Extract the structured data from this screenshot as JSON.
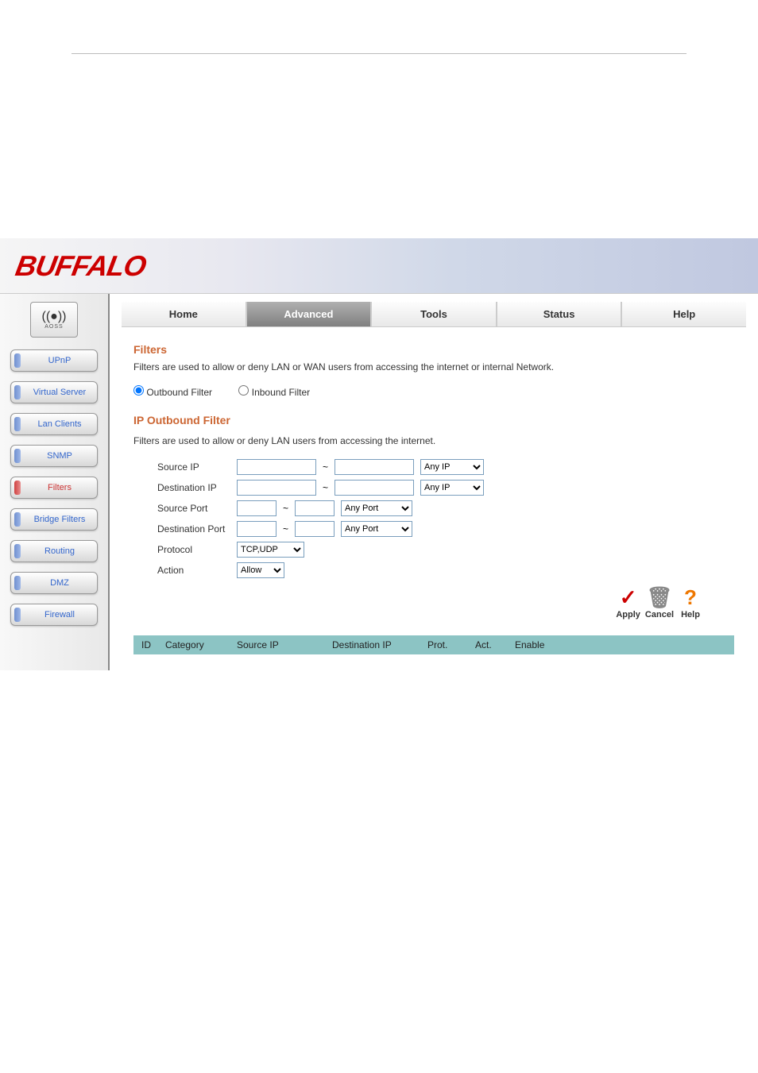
{
  "logo": "BUFFALO",
  "aoss": {
    "label": "AOSS"
  },
  "sidebar": {
    "items": [
      {
        "label": "UPnP",
        "active": false
      },
      {
        "label": "Virtual Server",
        "active": false
      },
      {
        "label": "Lan Clients",
        "active": false
      },
      {
        "label": "SNMP",
        "active": false
      },
      {
        "label": "Filters",
        "active": true
      },
      {
        "label": "Bridge Filters",
        "active": false
      },
      {
        "label": "Routing",
        "active": false
      },
      {
        "label": "DMZ",
        "active": false
      },
      {
        "label": "Firewall",
        "active": false
      }
    ]
  },
  "tabs": {
    "items": [
      {
        "label": "Home",
        "active": false
      },
      {
        "label": "Advanced",
        "active": true
      },
      {
        "label": "Tools",
        "active": false
      },
      {
        "label": "Status",
        "active": false
      },
      {
        "label": "Help",
        "active": false
      }
    ]
  },
  "filters": {
    "title": "Filters",
    "desc": "Filters are used to allow or deny LAN or WAN users from accessing the internet or internal Network.",
    "radio_outbound": "Outbound Filter",
    "radio_inbound": "Inbound Filter"
  },
  "outbound": {
    "title": "IP Outbound Filter",
    "desc": "Filters are used to allow or deny LAN users from accessing the internet.",
    "labels": {
      "source_ip": "Source IP",
      "dest_ip": "Destination IP",
      "source_port": "Source Port",
      "dest_port": "Destination Port",
      "protocol": "Protocol",
      "action": "Action"
    },
    "selects": {
      "any_ip": "Any IP",
      "any_port": "Any Port",
      "protocol": "TCP,UDP",
      "action": "Allow"
    }
  },
  "actions": {
    "apply": "Apply",
    "cancel": "Cancel",
    "help": "Help"
  },
  "table": {
    "headers": {
      "id": "ID",
      "category": "Category",
      "source_ip": "Source IP",
      "dest_ip": "Destination IP",
      "prot": "Prot.",
      "act": "Act.",
      "enable": "Enable"
    }
  }
}
